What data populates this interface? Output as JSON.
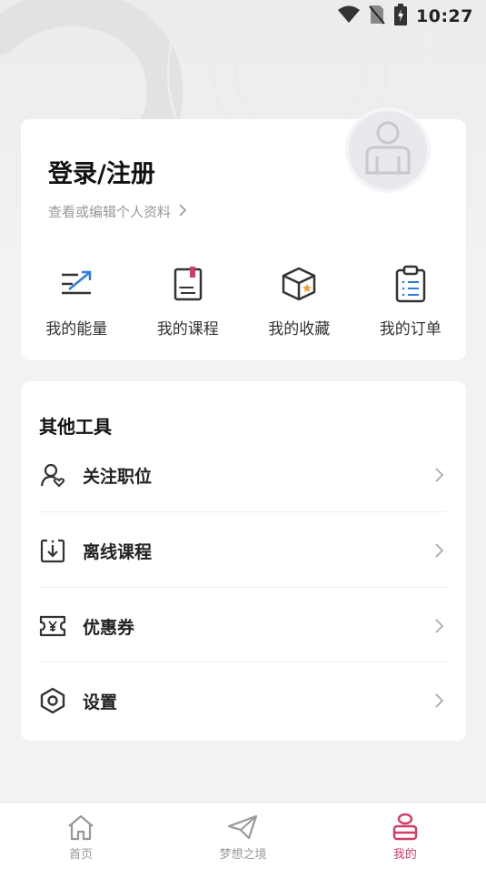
{
  "status_bar": {
    "time": "10:27"
  },
  "profile": {
    "login_label": "登录/注册",
    "edit_profile_label": "查看或编辑个人资料"
  },
  "quick_actions": [
    {
      "label": "我的能量",
      "icon": "energy-icon"
    },
    {
      "label": "我的课程",
      "icon": "course-book-icon"
    },
    {
      "label": "我的收藏",
      "icon": "favorites-box-icon"
    },
    {
      "label": "我的订单",
      "icon": "order-clipboard-icon"
    }
  ],
  "tools": {
    "title": "其他工具",
    "items": [
      {
        "label": "关注职位",
        "icon": "followed-position-icon"
      },
      {
        "label": "离线课程",
        "icon": "offline-download-icon"
      },
      {
        "label": "优惠券",
        "icon": "coupon-icon"
      },
      {
        "label": "设置",
        "icon": "settings-hexagon-icon"
      }
    ]
  },
  "tabbar": {
    "items": [
      {
        "label": "首页",
        "icon": "home-icon",
        "active": false
      },
      {
        "label": "梦想之境",
        "icon": "paper-plane-icon",
        "active": false
      },
      {
        "label": "我的",
        "icon": "profile-icon",
        "active": true
      }
    ]
  },
  "colors": {
    "accent": "#d23d66",
    "energy_blue": "#2d7de0",
    "favorite_orange": "#f0a030"
  }
}
